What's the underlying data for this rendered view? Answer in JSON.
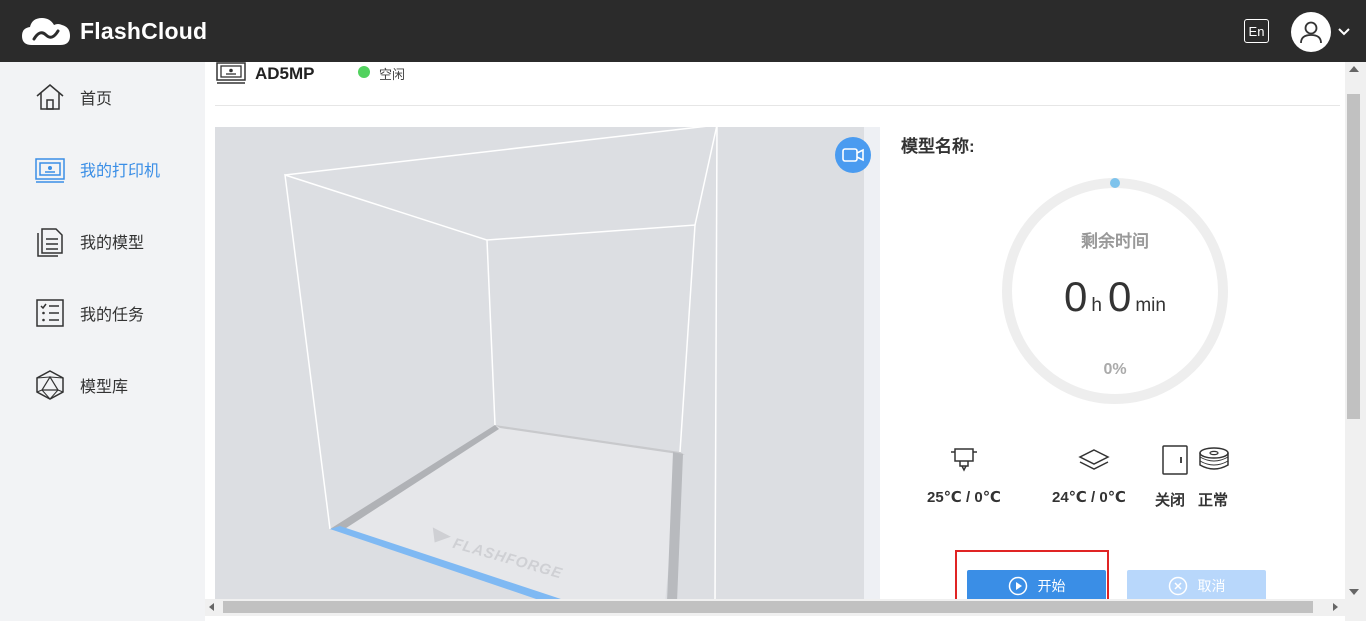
{
  "header": {
    "app_name": "FlashCloud",
    "lang_button": "En",
    "icons": {
      "logo": "cloud-logo-icon",
      "avatar": "user-avatar-icon",
      "caret": "chevron-down-icon"
    }
  },
  "sidebar": {
    "items": [
      {
        "label": "首页",
        "icon": "home-icon",
        "active": false
      },
      {
        "label": "我的打印机",
        "icon": "printer-icon",
        "active": true
      },
      {
        "label": "我的模型",
        "icon": "documents-icon",
        "active": false
      },
      {
        "label": "我的任务",
        "icon": "task-list-icon",
        "active": false
      },
      {
        "label": "模型库",
        "icon": "model-library-icon",
        "active": false
      }
    ]
  },
  "printer": {
    "name": "AD5MP",
    "status": "空闲",
    "status_color": "#52d25f"
  },
  "panel": {
    "model_label": "模型名称:",
    "remaining_label": "剩余时间",
    "hours": "0",
    "hours_unit": "h",
    "minutes": "0",
    "minutes_unit": "min",
    "progress_text": "0%",
    "progress": 0,
    "nozzle_temp": "25℃ / 0℃",
    "bed_temp": "24℃ / 0℃",
    "door_status": "关闭",
    "filament_status": "正常",
    "start_label": "开始",
    "cancel_label": "取消"
  },
  "colors": {
    "accent": "#3a8ee6",
    "header_bg": "#2b2b2b",
    "sidebar_bg": "#f2f3f5",
    "disabled_button": "#b8d7fb",
    "highlight": "#e02424"
  }
}
